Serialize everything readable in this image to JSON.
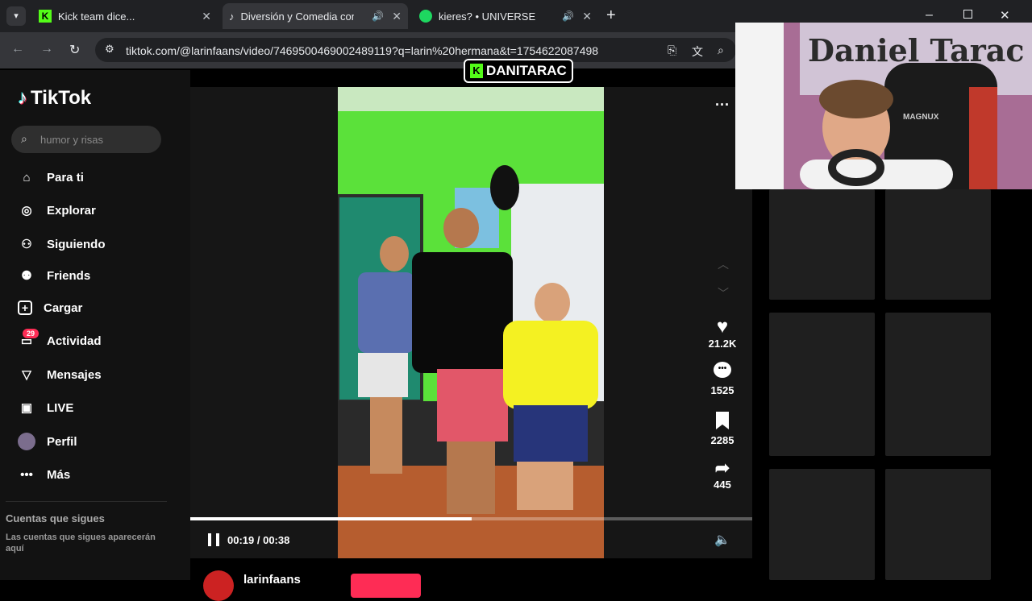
{
  "tabs": [
    {
      "title": "Kick team dice..."
    },
    {
      "title": "Diversión y Comedia con la"
    },
    {
      "title": "kieres? • UNIVERSE"
    }
  ],
  "url": "tiktok.com/@larinfaans/video/7469500469002489119?q=larin%20hermana&t=1754622087498",
  "overlay_tag": "DANITARAC",
  "webcam_wall_text": "Daniel Tarac",
  "chair_brand": "MAGNUX",
  "brand": "TikTok",
  "search_placeholder": "humor y risas",
  "nav": [
    "Para ti",
    "Explorar",
    "Siguiendo",
    "Friends",
    "Cargar",
    "Actividad",
    "Mensajes",
    "LIVE",
    "Perfil",
    "Más"
  ],
  "activity_badge": "29",
  "following_title": "Cuentas que sigues",
  "following_desc": "Las cuentas que sigues aparecerán aquí",
  "likes": "21.2K",
  "comments": "1525",
  "saves": "2285",
  "shares": "445",
  "time": "00:19 / 00:38",
  "progress": 0.5,
  "author": "larinfaans",
  "colors": {
    "tiktok_red": "#fe2c55",
    "green_screen": "#5be13a"
  }
}
